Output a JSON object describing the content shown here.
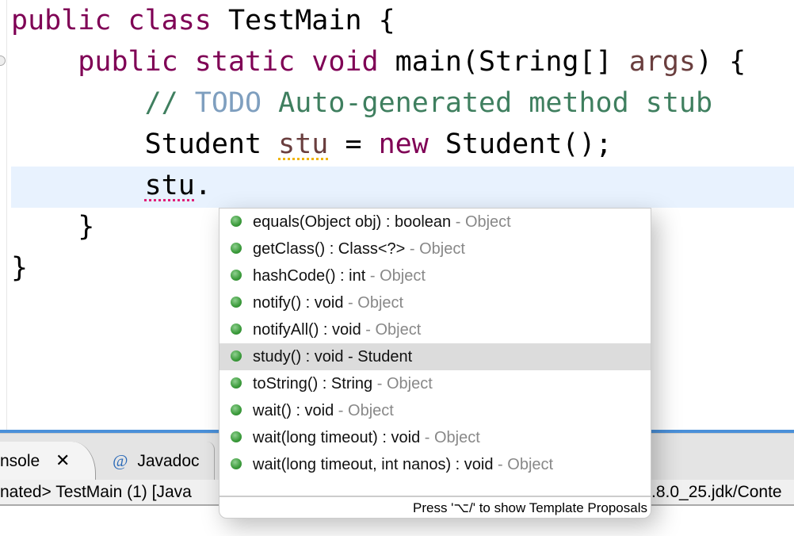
{
  "editor": {
    "lines": [
      {
        "kw": "public class ",
        "rest": "TestMain {"
      },
      {
        "kw": "public static void ",
        "rest": "main(String[] ",
        "var": "args",
        "tail": ") {"
      },
      {
        "comment_prefix": "// ",
        "todo": "TODO",
        "comment": " Auto-generated method stub"
      },
      {
        "type": "Student ",
        "var": "stu",
        "mid": " = ",
        "kw": "new",
        "rest": " Student();"
      },
      {
        "var": "stu",
        "rest": "."
      },
      {
        "rest": "}"
      },
      {
        "rest": "}"
      }
    ]
  },
  "bottom_panel": {
    "tabs": [
      {
        "label": "nsole",
        "close_icon": "close-icon"
      },
      {
        "label": "Javadoc",
        "icon": "at-icon",
        "icon_glyph": "@"
      }
    ],
    "status_left": "nated> TestMain (1) [Java",
    "status_right": ".8.0_25.jdk/Conte",
    "accent_color": "#4a90d9"
  },
  "popup": {
    "items": [
      {
        "sig": "equals(Object obj) : boolean",
        "owner": "Object"
      },
      {
        "sig": "getClass() : Class<?>",
        "owner": "Object"
      },
      {
        "sig": "hashCode() : int",
        "owner": "Object"
      },
      {
        "sig": "notify() : void",
        "owner": "Object"
      },
      {
        "sig": "notifyAll() : void",
        "owner": "Object"
      },
      {
        "sig": "study() : void",
        "owner": "Student",
        "selected": true
      },
      {
        "sig": "toString() : String",
        "owner": "Object"
      },
      {
        "sig": "wait() : void",
        "owner": "Object"
      },
      {
        "sig": "wait(long timeout) : void",
        "owner": "Object"
      },
      {
        "sig": "wait(long timeout, int nanos) : void",
        "owner": "Object"
      }
    ],
    "separator": " - ",
    "footer": "Press '⌥/' to show Template Proposals"
  }
}
